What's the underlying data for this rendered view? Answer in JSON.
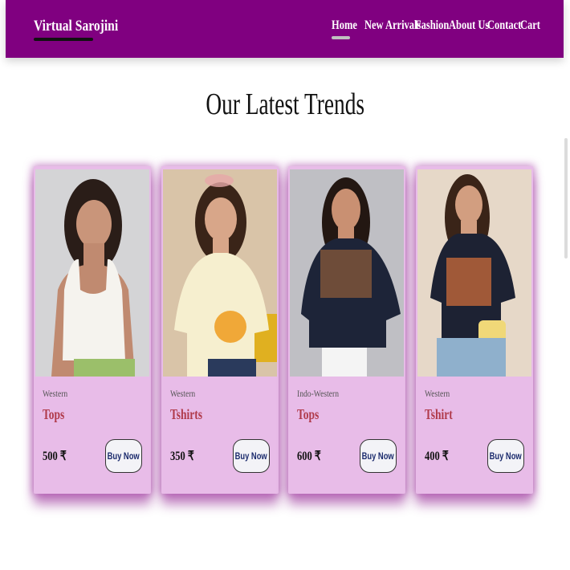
{
  "navbar": {
    "brand": "Virtual Sarojini",
    "links": [
      "Home",
      "New Arrivals",
      "Fashion",
      "About Us",
      "Contact",
      "Cart"
    ],
    "active": "Home",
    "background": "#800080"
  },
  "section": {
    "title": "Our Latest Trends"
  },
  "products": [
    {
      "image": "woman-white-tank-top-photo",
      "category": "Western",
      "name": "Tops",
      "price": "500 ₹",
      "button": "Buy Now"
    },
    {
      "image": "woman-cream-tshirt-photo",
      "category": "Western",
      "name": "Tshirts",
      "price": "350 ₹",
      "button": "Buy Now"
    },
    {
      "image": "woman-navy-embroidered-top-photo",
      "category": "Indo-Western",
      "name": "Tops",
      "price": "600 ₹",
      "button": "Buy Now"
    },
    {
      "image": "woman-navy-graphic-tshirt-photo",
      "category": "Western",
      "name": "Tshirt",
      "price": "400 ₹",
      "button": "Buy Now"
    }
  ],
  "colors": {
    "card_background": "#e8bce8",
    "product_name": "#b03a4a",
    "button_text": "#1a2a6c"
  }
}
